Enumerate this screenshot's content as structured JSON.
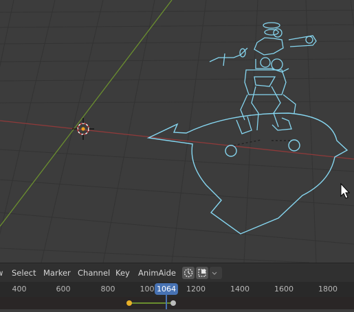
{
  "timeline": {
    "menu": [
      {
        "label": "w"
      },
      {
        "label": "Select"
      },
      {
        "label": "Marker"
      },
      {
        "label": "Channel"
      },
      {
        "label": "Key"
      },
      {
        "label": "AnimAide"
      }
    ],
    "ruler_ticks": [
      "400",
      "600",
      "800",
      "100",
      "1200",
      "1400",
      "1600",
      "1800"
    ],
    "current_frame": "1064",
    "icons": [
      "clock-icon",
      "keyframe-toggle-icon",
      "chevron-down-icon"
    ]
  },
  "viewport": {
    "objects": [
      "character-rig",
      "world-cursor",
      "root-control"
    ]
  },
  "colors": {
    "accent": "#4772b3",
    "rig_wire": "#86d6f0",
    "x_axis": "#9a3b3b",
    "y_axis": "#6b8f2f",
    "keyframe": "#e8b028"
  }
}
